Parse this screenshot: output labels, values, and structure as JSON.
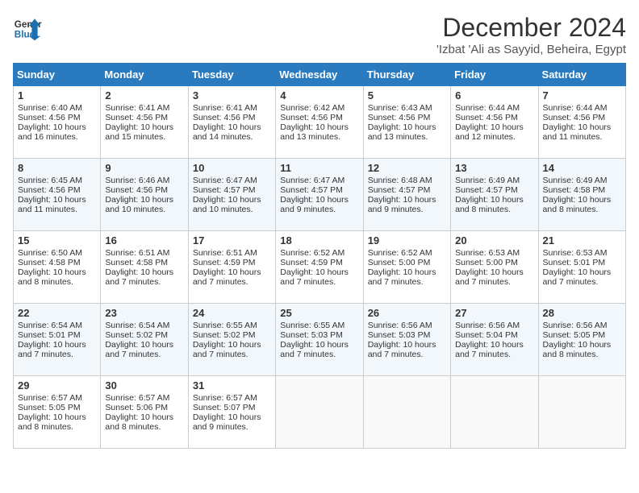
{
  "header": {
    "logo_line1": "General",
    "logo_line2": "Blue",
    "month": "December 2024",
    "location": "'Izbat 'Ali as Sayyid, Beheira, Egypt"
  },
  "weekdays": [
    "Sunday",
    "Monday",
    "Tuesday",
    "Wednesday",
    "Thursday",
    "Friday",
    "Saturday"
  ],
  "weeks": [
    [
      {
        "day": "1",
        "info": "Sunrise: 6:40 AM\nSunset: 4:56 PM\nDaylight: 10 hours\nand 16 minutes."
      },
      {
        "day": "2",
        "info": "Sunrise: 6:41 AM\nSunset: 4:56 PM\nDaylight: 10 hours\nand 15 minutes."
      },
      {
        "day": "3",
        "info": "Sunrise: 6:41 AM\nSunset: 4:56 PM\nDaylight: 10 hours\nand 14 minutes."
      },
      {
        "day": "4",
        "info": "Sunrise: 6:42 AM\nSunset: 4:56 PM\nDaylight: 10 hours\nand 13 minutes."
      },
      {
        "day": "5",
        "info": "Sunrise: 6:43 AM\nSunset: 4:56 PM\nDaylight: 10 hours\nand 13 minutes."
      },
      {
        "day": "6",
        "info": "Sunrise: 6:44 AM\nSunset: 4:56 PM\nDaylight: 10 hours\nand 12 minutes."
      },
      {
        "day": "7",
        "info": "Sunrise: 6:44 AM\nSunset: 4:56 PM\nDaylight: 10 hours\nand 11 minutes."
      }
    ],
    [
      {
        "day": "8",
        "info": "Sunrise: 6:45 AM\nSunset: 4:56 PM\nDaylight: 10 hours\nand 11 minutes."
      },
      {
        "day": "9",
        "info": "Sunrise: 6:46 AM\nSunset: 4:56 PM\nDaylight: 10 hours\nand 10 minutes."
      },
      {
        "day": "10",
        "info": "Sunrise: 6:47 AM\nSunset: 4:57 PM\nDaylight: 10 hours\nand 10 minutes."
      },
      {
        "day": "11",
        "info": "Sunrise: 6:47 AM\nSunset: 4:57 PM\nDaylight: 10 hours\nand 9 minutes."
      },
      {
        "day": "12",
        "info": "Sunrise: 6:48 AM\nSunset: 4:57 PM\nDaylight: 10 hours\nand 9 minutes."
      },
      {
        "day": "13",
        "info": "Sunrise: 6:49 AM\nSunset: 4:57 PM\nDaylight: 10 hours\nand 8 minutes."
      },
      {
        "day": "14",
        "info": "Sunrise: 6:49 AM\nSunset: 4:58 PM\nDaylight: 10 hours\nand 8 minutes."
      }
    ],
    [
      {
        "day": "15",
        "info": "Sunrise: 6:50 AM\nSunset: 4:58 PM\nDaylight: 10 hours\nand 8 minutes."
      },
      {
        "day": "16",
        "info": "Sunrise: 6:51 AM\nSunset: 4:58 PM\nDaylight: 10 hours\nand 7 minutes."
      },
      {
        "day": "17",
        "info": "Sunrise: 6:51 AM\nSunset: 4:59 PM\nDaylight: 10 hours\nand 7 minutes."
      },
      {
        "day": "18",
        "info": "Sunrise: 6:52 AM\nSunset: 4:59 PM\nDaylight: 10 hours\nand 7 minutes."
      },
      {
        "day": "19",
        "info": "Sunrise: 6:52 AM\nSunset: 5:00 PM\nDaylight: 10 hours\nand 7 minutes."
      },
      {
        "day": "20",
        "info": "Sunrise: 6:53 AM\nSunset: 5:00 PM\nDaylight: 10 hours\nand 7 minutes."
      },
      {
        "day": "21",
        "info": "Sunrise: 6:53 AM\nSunset: 5:01 PM\nDaylight: 10 hours\nand 7 minutes."
      }
    ],
    [
      {
        "day": "22",
        "info": "Sunrise: 6:54 AM\nSunset: 5:01 PM\nDaylight: 10 hours\nand 7 minutes."
      },
      {
        "day": "23",
        "info": "Sunrise: 6:54 AM\nSunset: 5:02 PM\nDaylight: 10 hours\nand 7 minutes."
      },
      {
        "day": "24",
        "info": "Sunrise: 6:55 AM\nSunset: 5:02 PM\nDaylight: 10 hours\nand 7 minutes."
      },
      {
        "day": "25",
        "info": "Sunrise: 6:55 AM\nSunset: 5:03 PM\nDaylight: 10 hours\nand 7 minutes."
      },
      {
        "day": "26",
        "info": "Sunrise: 6:56 AM\nSunset: 5:03 PM\nDaylight: 10 hours\nand 7 minutes."
      },
      {
        "day": "27",
        "info": "Sunrise: 6:56 AM\nSunset: 5:04 PM\nDaylight: 10 hours\nand 7 minutes."
      },
      {
        "day": "28",
        "info": "Sunrise: 6:56 AM\nSunset: 5:05 PM\nDaylight: 10 hours\nand 8 minutes."
      }
    ],
    [
      {
        "day": "29",
        "info": "Sunrise: 6:57 AM\nSunset: 5:05 PM\nDaylight: 10 hours\nand 8 minutes."
      },
      {
        "day": "30",
        "info": "Sunrise: 6:57 AM\nSunset: 5:06 PM\nDaylight: 10 hours\nand 8 minutes."
      },
      {
        "day": "31",
        "info": "Sunrise: 6:57 AM\nSunset: 5:07 PM\nDaylight: 10 hours\nand 9 minutes."
      },
      {
        "day": "",
        "info": ""
      },
      {
        "day": "",
        "info": ""
      },
      {
        "day": "",
        "info": ""
      },
      {
        "day": "",
        "info": ""
      }
    ]
  ]
}
